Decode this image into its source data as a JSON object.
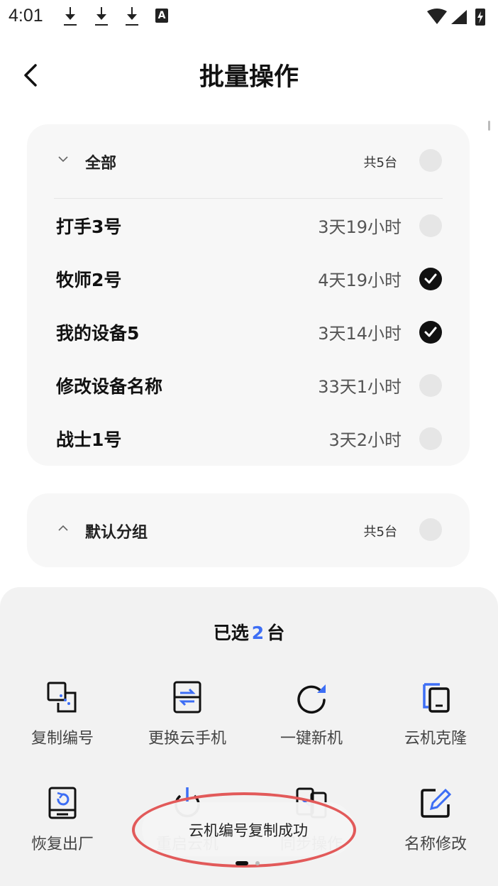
{
  "status_bar": {
    "time": "4:01",
    "badge": "A"
  },
  "header": {
    "title": "批量操作",
    "back_icon": "chevron-left-icon"
  },
  "group_all": {
    "title": "全部",
    "count": "共5台",
    "expanded": true,
    "devices": [
      {
        "name": "打手3号",
        "time": "3天19小时",
        "checked": false
      },
      {
        "name": "牧师2号",
        "time": "4天19小时",
        "checked": true
      },
      {
        "name": "我的设备5",
        "time": "3天14小时",
        "checked": true
      },
      {
        "name": "修改设备名称",
        "time": "33天1小时",
        "checked": false
      },
      {
        "name": "战士1号",
        "time": "3天2小时",
        "checked": false
      }
    ]
  },
  "group_default": {
    "title": "默认分组",
    "count": "共5台",
    "expanded": false
  },
  "sheet": {
    "selected_prefix": "已选",
    "selected_count": "2",
    "selected_suffix": "台",
    "actions": [
      {
        "label": "复制编号",
        "icon": "copy-id-icon"
      },
      {
        "label": "更换云手机",
        "icon": "swap-phone-icon"
      },
      {
        "label": "一键新机",
        "icon": "refresh-icon"
      },
      {
        "label": "云机克隆",
        "icon": "clone-icon"
      },
      {
        "label": "恢复出厂",
        "icon": "factory-reset-icon"
      },
      {
        "label": "重启云机",
        "icon": "power-icon"
      },
      {
        "label": "同步操作",
        "icon": "sync-icon"
      },
      {
        "label": "名称修改",
        "icon": "edit-icon"
      }
    ]
  },
  "toast": {
    "text": "云机编号复制成功"
  },
  "colors": {
    "accent": "#3d6ef5",
    "highlight_ring": "#e25a5a",
    "card_bg": "#f7f7f7"
  }
}
